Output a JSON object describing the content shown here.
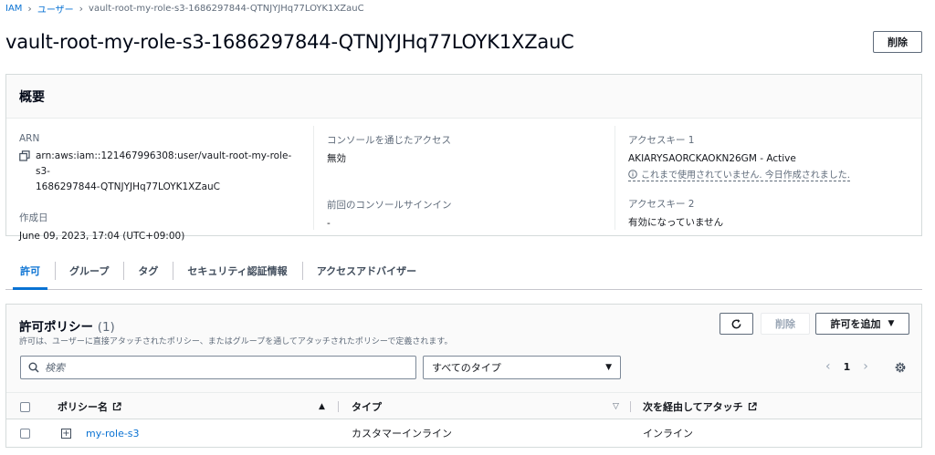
{
  "breadcrumb": {
    "root": "IAM",
    "section": "ユーザー",
    "current": "vault-root-my-role-s3-1686297844-QTNJYJHq77LOYK1XZauC"
  },
  "header": {
    "title": "vault-root-my-role-s3-1686297844-QTNJYJHq77LOYK1XZauC",
    "delete_label": "削除"
  },
  "summary": {
    "title": "概要",
    "arn_label": "ARN",
    "arn_line1": "arn:aws:iam::121467996308:user/vault-root-my-role-s3-",
    "arn_line2": "1686297844-QTNJYJHq77LOYK1XZauC",
    "created_label": "作成日",
    "created_value": "June 09, 2023, 17:04 (UTC+09:00)",
    "console_access_label": "コンソールを通じたアクセス",
    "console_access_value": "無効",
    "last_signin_label": "前回のコンソールサインイン",
    "last_signin_value": "-",
    "access_key1_label": "アクセスキー 1",
    "access_key1_value": "AKIARYSAORCKAOKN26GM - Active",
    "access_key1_note": "これまで使用されていません. 今日作成されました.",
    "access_key2_label": "アクセスキー 2",
    "access_key2_value": "有効になっていません"
  },
  "tabs": [
    "許可",
    "グループ",
    "タグ",
    "セキュリティ認証情報",
    "アクセスアドバイザー"
  ],
  "permissions": {
    "title": "許可ポリシー",
    "count": "(1)",
    "description": "許可は、ユーザーに直接アタッチされたポリシー、またはグループを通してアタッチされたポリシーで定義されます。",
    "delete_label": "削除",
    "add_label": "許可を追加",
    "search_placeholder": "検索",
    "type_filter": "すべてのタイプ",
    "page": "1",
    "columns": {
      "policy_name": "ポリシー名",
      "type": "タイプ",
      "attached_via": "次を経由してアタッチ"
    },
    "rows": [
      {
        "policy_name": "my-role-s3",
        "type": "カスタマーインライン",
        "attached_via": "インライン"
      }
    ]
  }
}
